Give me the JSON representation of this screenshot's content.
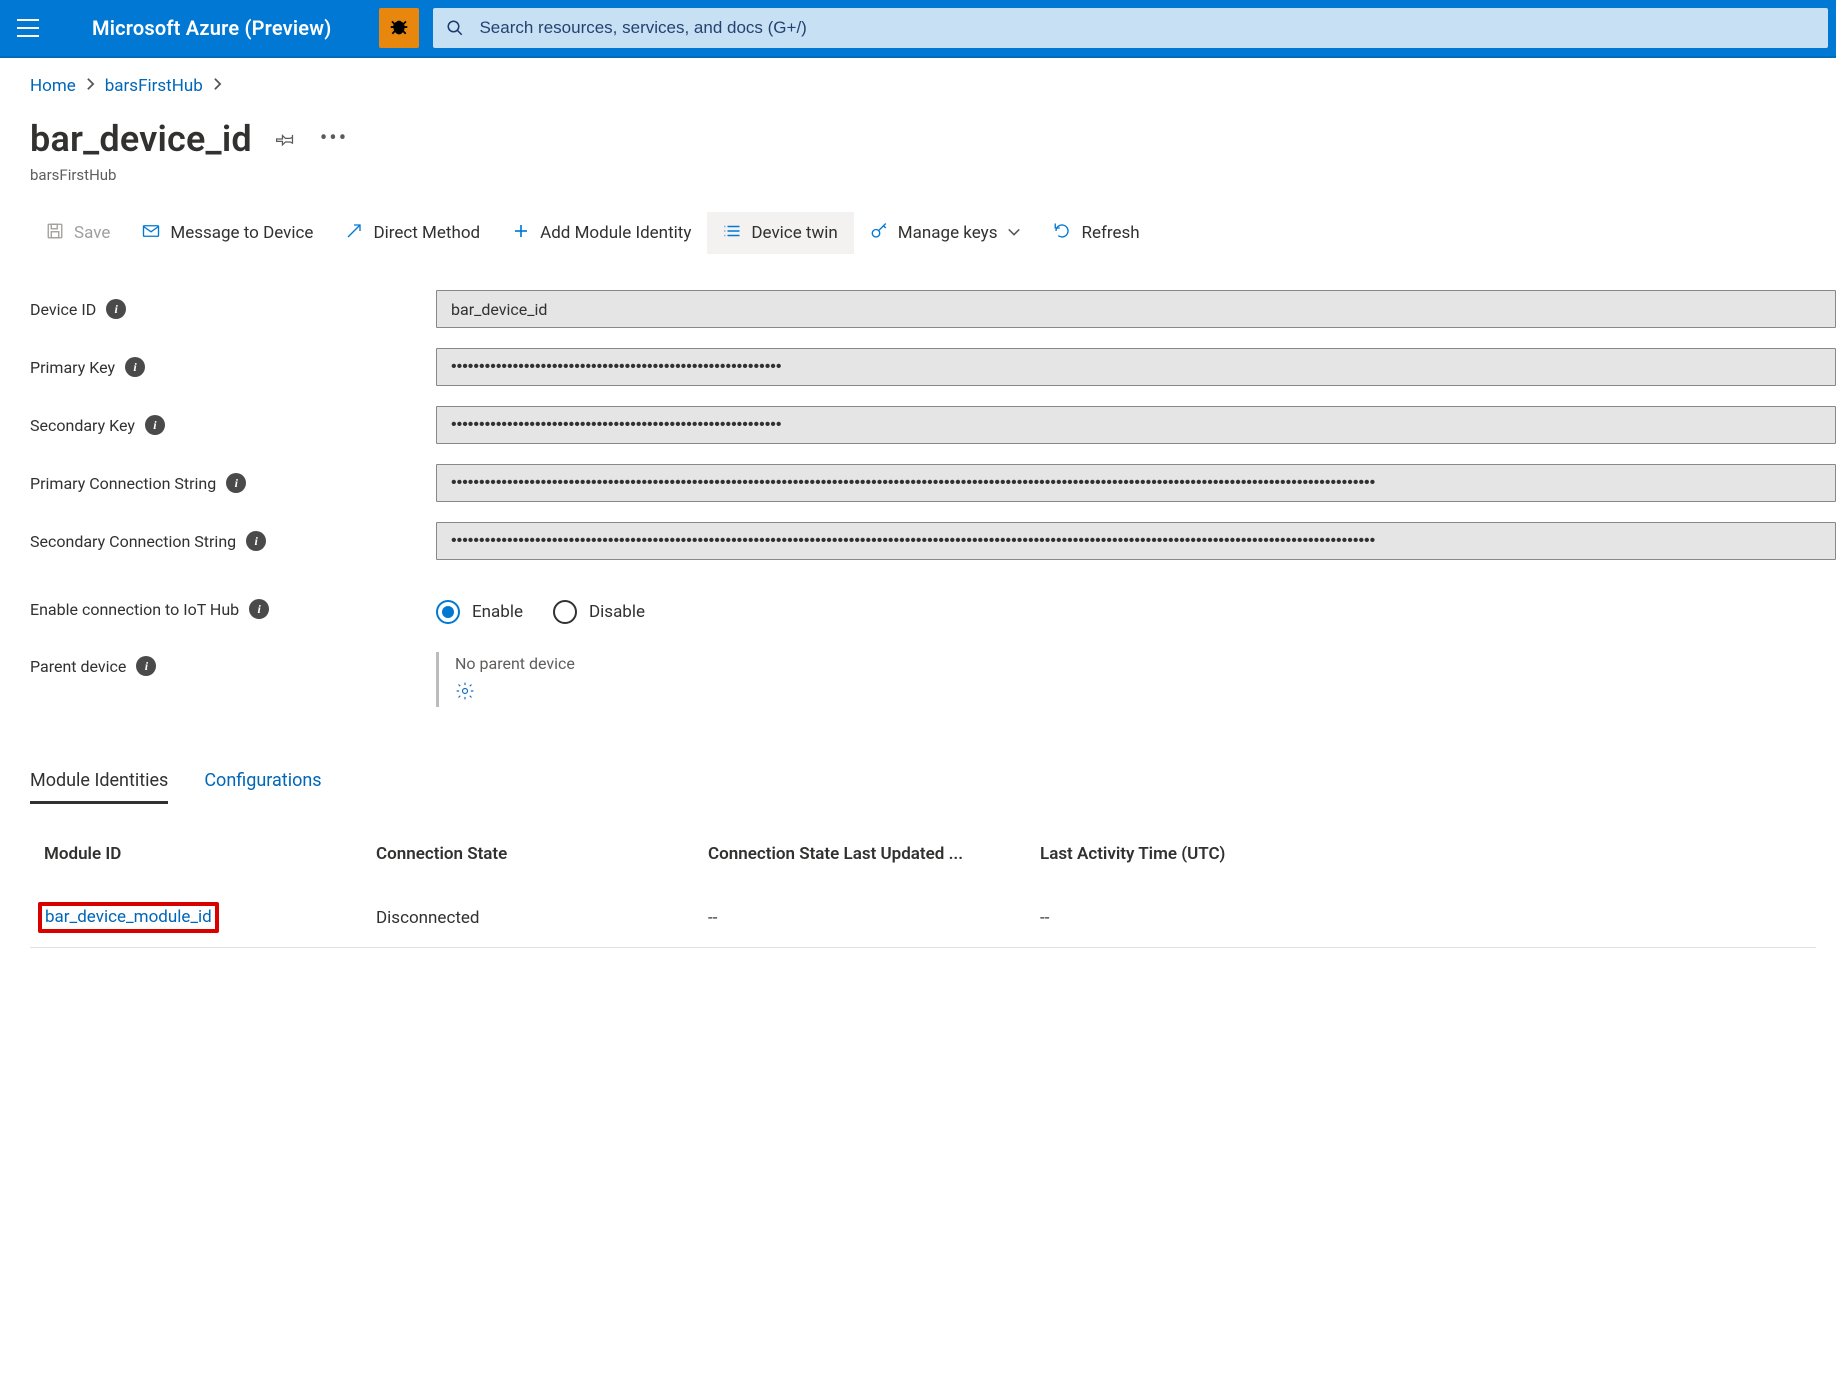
{
  "header": {
    "brand": "Microsoft Azure (Preview)",
    "search_placeholder": "Search resources, services, and docs (G+/)"
  },
  "breadcrumb": {
    "home": "Home",
    "hub": "barsFirstHub"
  },
  "page": {
    "title": "bar_device_id",
    "subtitle": "barsFirstHub"
  },
  "toolbar": {
    "save": "Save",
    "message": "Message to Device",
    "direct_method": "Direct Method",
    "add_module": "Add Module Identity",
    "device_twin": "Device twin",
    "manage_keys": "Manage keys",
    "refresh": "Refresh"
  },
  "form": {
    "device_id_label": "Device ID",
    "device_id_value": "bar_device_id",
    "primary_key_label": "Primary Key",
    "primary_key_value": "•••••••••••••••••••••••••••••••••••••••••••••••••••••••••••",
    "secondary_key_label": "Secondary Key",
    "secondary_key_value": "•••••••••••••••••••••••••••••••••••••••••••••••••••••••••••",
    "primary_conn_label": "Primary Connection String",
    "primary_conn_value": "•••••••••••••••••••••••••••••••••••••••••••••••••••••••••••••••••••••••••••••••••••••••••••••••••••••••••••••••••••••••••••••••••••••••••••••••••••••••••••••••••••••",
    "secondary_conn_label": "Secondary Connection String",
    "secondary_conn_value": "•••••••••••••••••••••••••••••••••••••••••••••••••••••••••••••••••••••••••••••••••••••••••••••••••••••••••••••••••••••••••••••••••••••••••••••••••••••••••••••••••••••",
    "enable_conn_label": "Enable connection to IoT Hub",
    "enable_option": "Enable",
    "disable_option": "Disable",
    "parent_label": "Parent device",
    "parent_value": "No parent device"
  },
  "tabs": {
    "module_identities": "Module Identities",
    "configurations": "Configurations"
  },
  "table": {
    "headers": {
      "module_id": "Module ID",
      "conn_state": "Connection State",
      "conn_state_updated": "Connection State Last Updated ...",
      "last_activity": "Last Activity Time (UTC)"
    },
    "rows": [
      {
        "module_id": "bar_device_module_id",
        "conn_state": "Disconnected",
        "conn_state_updated": "--",
        "last_activity": "--"
      }
    ]
  }
}
